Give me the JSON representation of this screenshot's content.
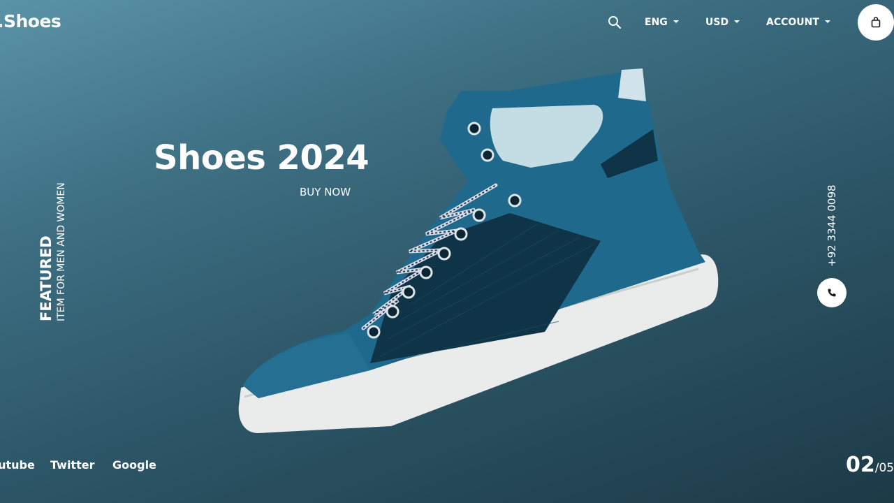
{
  "brand": {
    "logo": ".Shoes"
  },
  "header": {
    "search_icon": "search-icon",
    "language": "ENG",
    "currency": "USD",
    "account": "ACCOUNT",
    "cart_icon": "shopping-bag-icon"
  },
  "hero": {
    "title": "Shoes 2024",
    "cta": "BUY NOW"
  },
  "side": {
    "featured": "FEATURED",
    "subtitle": "ITEM FOR MEN AND WOMEN"
  },
  "contact": {
    "phone": "+92 3344 0098",
    "phone_icon": "phone-icon"
  },
  "socials": {
    "youtube": "Youtube",
    "twitter": "Twitter",
    "google": "Google"
  },
  "pager": {
    "current": "02",
    "total": "/05"
  },
  "colors": {
    "bg_top": "#5a93a8",
    "bg_bottom": "#1d3a47",
    "shoe_blue": "#1f6a8c",
    "sole": "#e8ece9"
  }
}
